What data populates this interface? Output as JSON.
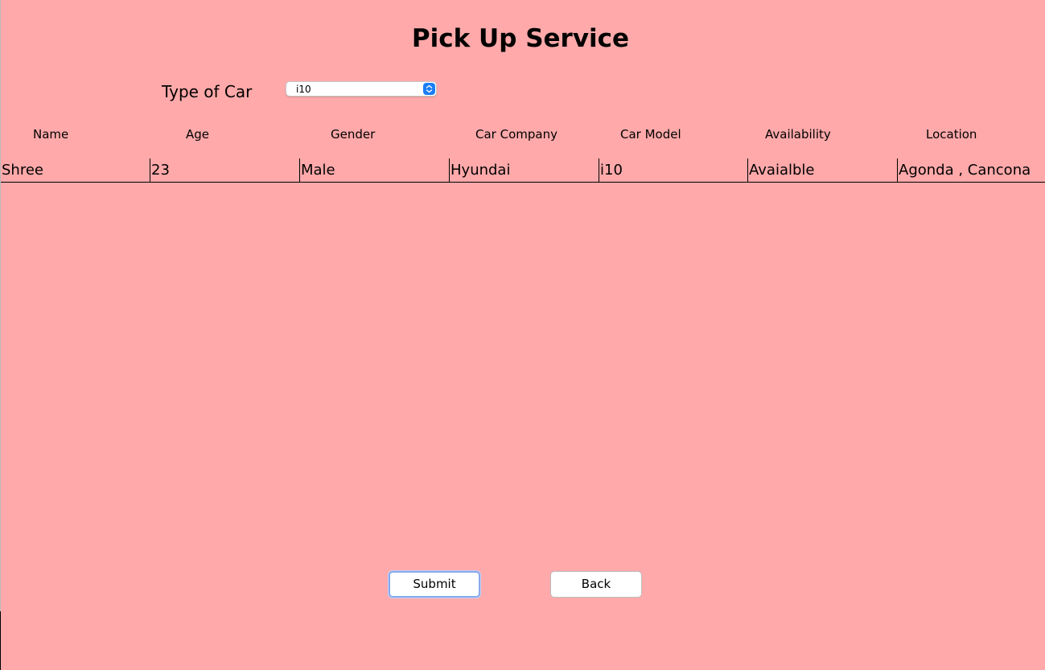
{
  "page": {
    "title": "Pick Up Service",
    "background_color": "#ffa9aa"
  },
  "car_type": {
    "label": "Type of Car",
    "selected": "i10",
    "icon": "chevron-up-down-icon"
  },
  "table": {
    "headers": [
      "Name",
      "Age",
      "Gender",
      "Car Company",
      "Car Model",
      "Availability",
      "Location"
    ],
    "rows": [
      [
        "Shree",
        "23",
        "Male",
        "Hyundai",
        "i10",
        "Avaialble",
        "Agonda , Cancona"
      ]
    ]
  },
  "buttons": {
    "submit": "Submit",
    "back": "Back"
  }
}
